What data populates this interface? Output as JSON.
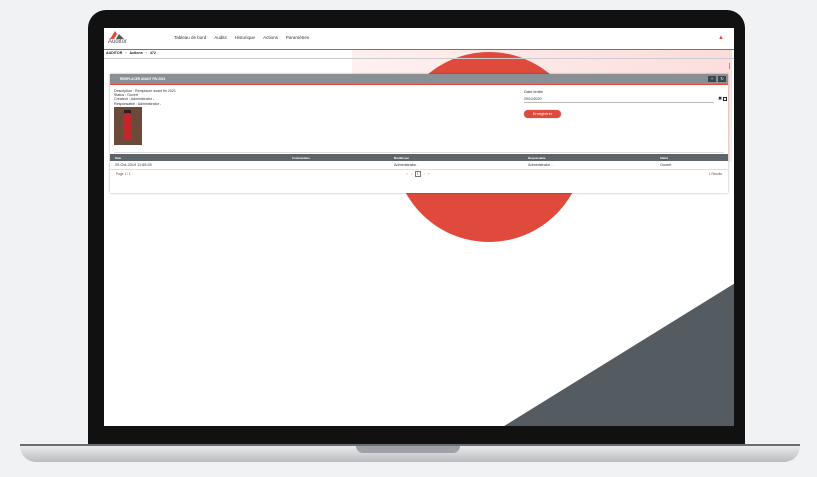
{
  "app": {
    "logo_text": "Auditor",
    "nav": [
      "Tableau de bord",
      "Audits",
      "Historique",
      "Actions",
      "Paramètres"
    ],
    "alert_icon": "warning-triangle-icon"
  },
  "breadcrumb": [
    "AUDITOR",
    "Actions",
    "472"
  ],
  "panel": {
    "title": "REMPLACER AVANT FIN 2021",
    "add_icon": "plus-icon",
    "refresh_icon": "refresh-icon",
    "info": {
      "description": "Description : Remplacer avant fin 2021",
      "status": "Status : Ouvert",
      "creator": "Créateur : Administrator -",
      "responsible": "Responsable : Administrator -"
    },
    "due_label": "Date limite",
    "due_value": "29/10/2020",
    "save_label": "Enregistrer"
  },
  "table": {
    "columns": [
      "Date",
      "Commentaire",
      "Modifié par",
      "Responsable",
      "Statut"
    ],
    "rows": [
      [
        "29-Oct-2019 11:55:28",
        "",
        "Administrator -",
        "Administrator -",
        "Ouvert"
      ]
    ]
  },
  "pager": {
    "page_label": "Page 1 / 1",
    "prev_first": "«",
    "prev": "‹",
    "current": "1",
    "next": "›",
    "next_last": "»",
    "results": "1 Results"
  },
  "colors": {
    "accent": "#e04a3c",
    "header_gray": "#8a8f94",
    "table_header": "#5d656b",
    "dark_shape": "#545b61"
  }
}
